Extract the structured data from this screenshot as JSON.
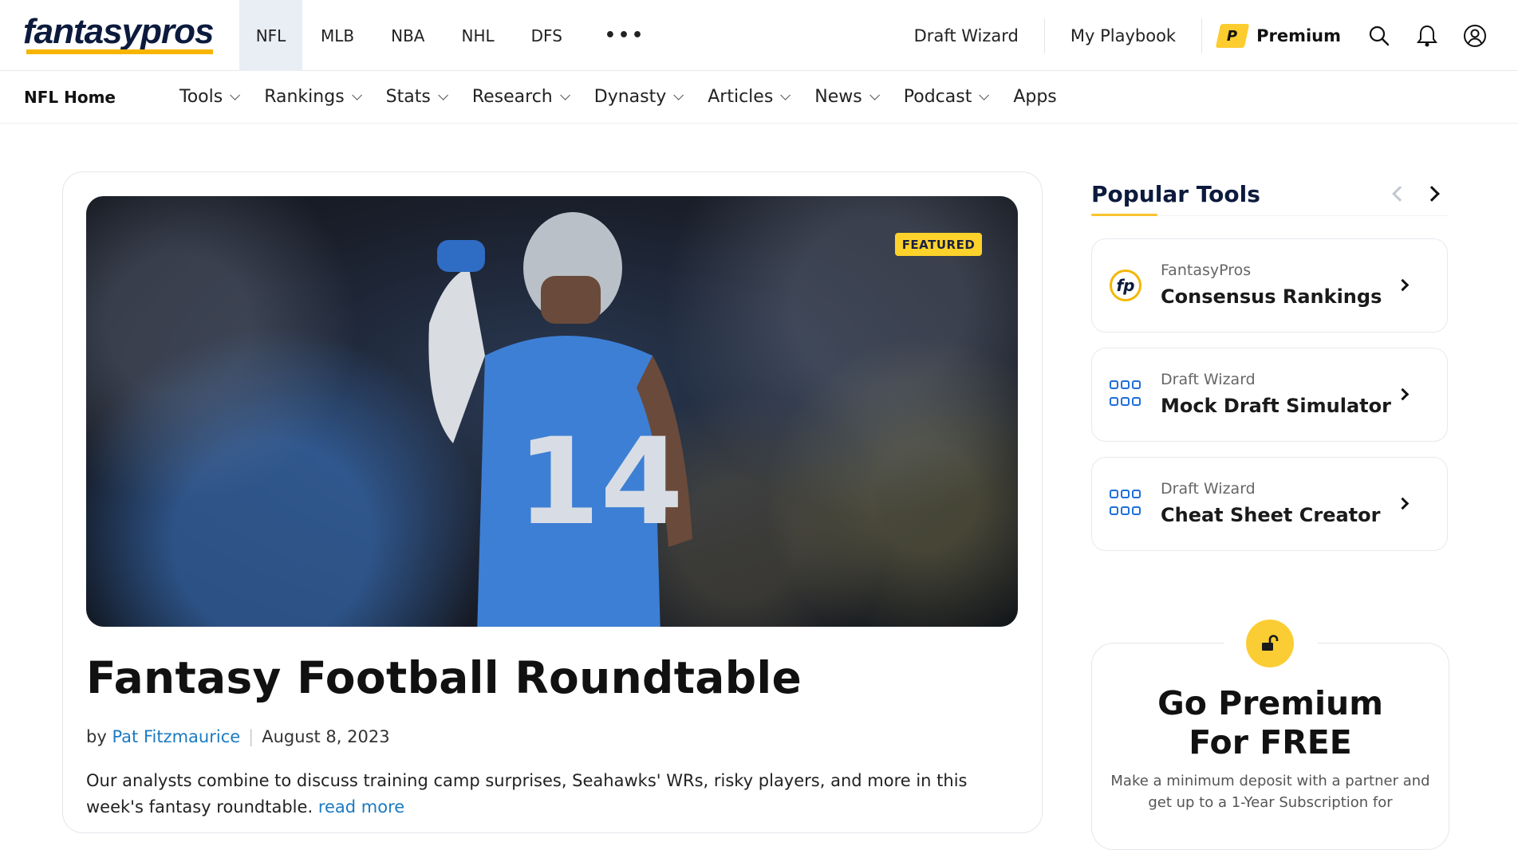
{
  "header": {
    "logo": "fantasypros",
    "sports": [
      {
        "label": "NFL",
        "active": true
      },
      {
        "label": "MLB"
      },
      {
        "label": "NBA"
      },
      {
        "label": "NHL"
      },
      {
        "label": "DFS"
      }
    ],
    "more": "•••",
    "right_links": [
      "Draft Wizard",
      "My Playbook"
    ],
    "premium_badge": "P",
    "premium_label": "Premium",
    "icons": [
      "search-icon",
      "bell-icon",
      "user-icon"
    ]
  },
  "subnav": {
    "home": "NFL Home",
    "items": [
      {
        "label": "Tools",
        "dropdown": true
      },
      {
        "label": "Rankings",
        "dropdown": true
      },
      {
        "label": "Stats",
        "dropdown": true
      },
      {
        "label": "Research",
        "dropdown": true
      },
      {
        "label": "Dynasty",
        "dropdown": true
      },
      {
        "label": "Articles",
        "dropdown": true
      },
      {
        "label": "News",
        "dropdown": true
      },
      {
        "label": "Podcast",
        "dropdown": true
      },
      {
        "label": "Apps",
        "dropdown": false
      }
    ]
  },
  "article": {
    "badge": "FEATURED",
    "jersey": "14",
    "title": "Fantasy Football Roundtable",
    "by": "by",
    "author": "Pat Fitzmaurice",
    "date": "August 8, 2023",
    "excerpt": "Our analysts combine to discuss training camp surprises, Seahawks' WRs, risky players, and more in this week's fantasy roundtable.",
    "read_more": "read more"
  },
  "popular_tools": {
    "heading": "Popular Tools",
    "items": [
      {
        "icon": "fp",
        "category": "FantasyPros",
        "name": "Consensus Rankings"
      },
      {
        "icon": "grid",
        "category": "Draft Wizard",
        "name": "Mock Draft Simulator"
      },
      {
        "icon": "grid",
        "category": "Draft Wizard",
        "name": "Cheat Sheet Creator"
      }
    ]
  },
  "premium_card": {
    "title_line1": "Go Premium",
    "title_line2": "For FREE",
    "text": "Make a minimum deposit with a partner and get up to a 1-Year Subscription for"
  },
  "colors": {
    "brand_navy": "#0c1b3d",
    "brand_yellow": "#fdcc2e",
    "link_blue": "#1b7bc1",
    "tool_icon_blue": "#1e6fd9"
  }
}
